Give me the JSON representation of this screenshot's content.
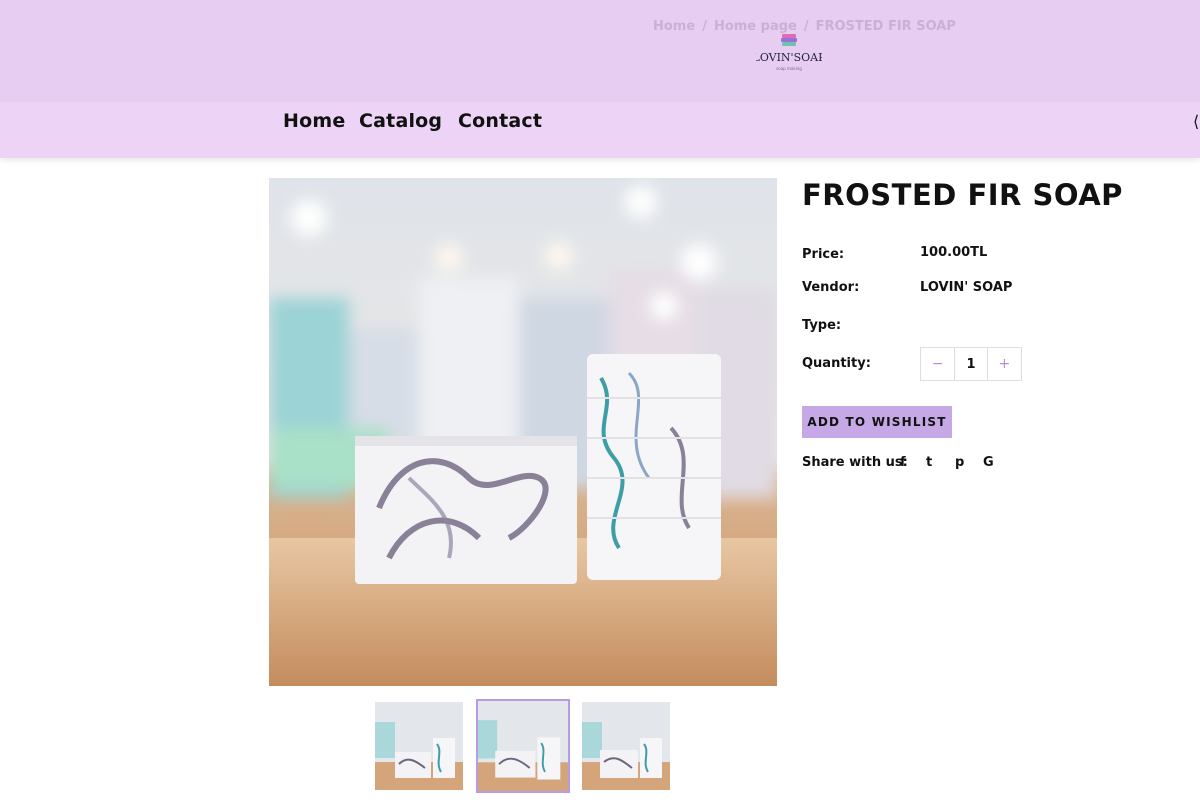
{
  "breadcrumb": {
    "items": [
      "Home",
      "Home page",
      "FROSTED FIR SOAP"
    ],
    "separator": "/"
  },
  "brand": {
    "logo_text": "LOVIN' SOAP"
  },
  "nav": {
    "items": [
      "Home",
      "Catalog",
      "Contact"
    ]
  },
  "product": {
    "title": "FROSTED FIR SOAP",
    "price_label": "Price:",
    "price_value": "100.00TL",
    "vendor_label": "Vendor:",
    "vendor_value": "LOVIN' SOAP",
    "type_label": "Type:",
    "type_value": "",
    "quantity_label": "Quantity:",
    "quantity_value": "1",
    "minus": "−",
    "plus": "+",
    "wishlist_label": "ADD TO WISHLIST",
    "share_label": "Share with us:",
    "share_icons": [
      "f",
      "t",
      "p",
      "G"
    ]
  },
  "gallery": {
    "thumbnail_count": 3,
    "selected_index": 1
  },
  "colors": {
    "header_bg": "#e7cdf2",
    "nav_bg": "#edd3f5",
    "accent": "#c7a8e6",
    "thumb_border": "#b89be0"
  }
}
